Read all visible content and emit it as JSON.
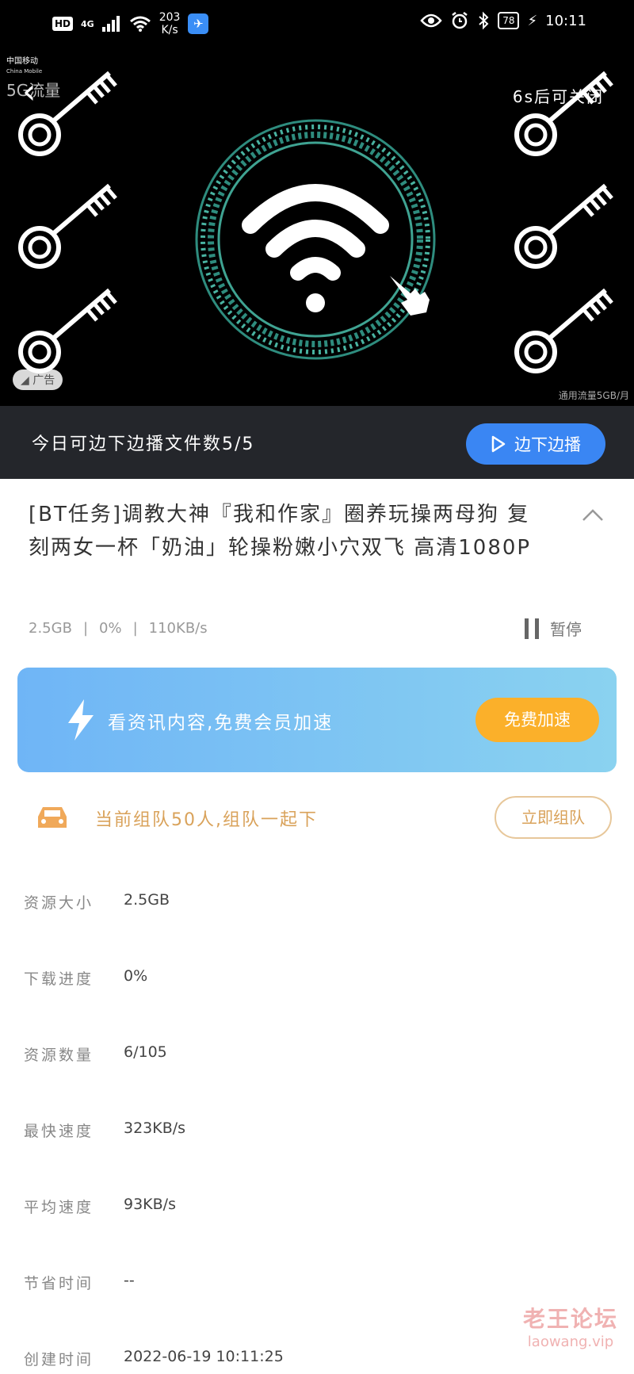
{
  "status_bar": {
    "hd": "HD",
    "network": "4G",
    "speed_value": "203",
    "speed_unit": "K/s",
    "battery": "78",
    "time": "10:11"
  },
  "ad": {
    "carrier_name": "中国移动",
    "carrier_sub": "China Mobile",
    "flow_label": "5G流量",
    "close_hint": "6s后可关闭",
    "ad_tag": "广告",
    "footer_note": "通用流量5GB/月"
  },
  "playbar": {
    "text": "今日可边下边播文件数5/5",
    "button": "边下边播"
  },
  "task": {
    "title": "[BT任务]调教大神『我和作家』圈养玩操两母狗 复刻两女一杯「奶油」轮操粉嫩小穴双飞 高清1080P",
    "size": "2.5GB",
    "progress": "0%",
    "speed": "110KB/s",
    "pause_label": "暂停"
  },
  "boost": {
    "text": "看资讯内容,免费会员加速",
    "button": "免费加速"
  },
  "team": {
    "text": "当前组队50人,组队一起下",
    "button": "立即组队"
  },
  "details": [
    {
      "label": "资源大小",
      "value": "2.5GB"
    },
    {
      "label": "下载进度",
      "value": "0%"
    },
    {
      "label": "资源数量",
      "value": "6/105"
    },
    {
      "label": "最快速度",
      "value": "323KB/s"
    },
    {
      "label": "平均速度",
      "value": "93KB/s"
    },
    {
      "label": "节省时间",
      "value": "--"
    },
    {
      "label": "创建时间",
      "value": "2022-06-19 10:11:25"
    }
  ],
  "watermark": {
    "line1": "老王论坛",
    "line2": "laowang.vip"
  },
  "colors": {
    "play_button": "#3a86f3",
    "boost_button": "#fbb02a",
    "team_accent": "#d9a25a"
  }
}
